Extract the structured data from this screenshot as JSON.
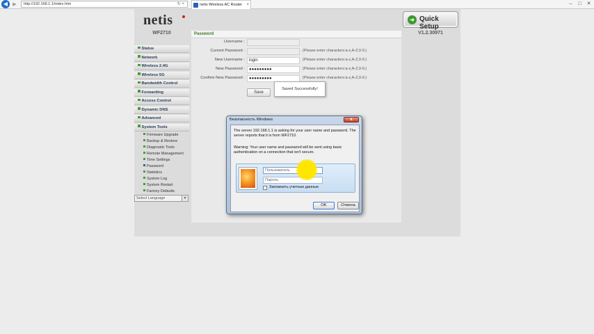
{
  "browser": {
    "url": "http://192.168.1.1/index.htm",
    "tab_title": "netis Wireless AC Router"
  },
  "router": {
    "logo": "netis",
    "model": "WF2710",
    "version": "V1.2.30971",
    "quick_setup": "Quick Setup",
    "sidebar": [
      {
        "label": "Status"
      },
      {
        "label": "Network"
      },
      {
        "label": "Wireless 2.4G"
      },
      {
        "label": "Wireless 5G"
      },
      {
        "label": "Bandwidth Control"
      },
      {
        "label": "Forwarding"
      },
      {
        "label": "Access Control"
      },
      {
        "label": "Dynamic DNS"
      },
      {
        "label": "Advanced"
      },
      {
        "label": "System Tools"
      }
    ],
    "system_tools_sub": [
      "Firmware Upgrade",
      "Backup & Restore",
      "Diagnostic Tools",
      "Remote Management",
      "Time Settings",
      "Password",
      "Statistics",
      "System Log",
      "System Restart",
      "Factory Defaults"
    ],
    "language": "Select Language",
    "panel_title": "Password",
    "form": {
      "username_label": "Username :",
      "username_value": "",
      "current_password_label": "Current Password :",
      "current_password_value": "",
      "new_username_label": "New Username :",
      "new_username_value": "login",
      "new_password_label": "New Password :",
      "new_password_value": "●●●●●●●●●",
      "confirm_password_label": "Confirm New Password :",
      "confirm_password_value": "●●●●●●●●●",
      "hint": "(Please enter characters:a-z,A-Z,0-9.)",
      "save_label": "Save"
    },
    "toast": "Saved Successfully!"
  },
  "dialog": {
    "title": "Безопасность Windows",
    "message": "The server 192.168.1.1 is asking for your user name and password. The server reports that it is from WF2710.",
    "warning": "Warning: Your user name and password will be sent using basic authentication on a connection that isn't secure.",
    "user_placeholder": "Пользователь",
    "password_placeholder": "Пароль",
    "remember": "Запомнить учетные данные",
    "ok": "OK",
    "cancel": "Отмена"
  },
  "colors": {
    "accent_green": "#3b7a2a",
    "sidebar_marker": "#4a9a3a",
    "cursor_highlight": "#ffe600"
  }
}
